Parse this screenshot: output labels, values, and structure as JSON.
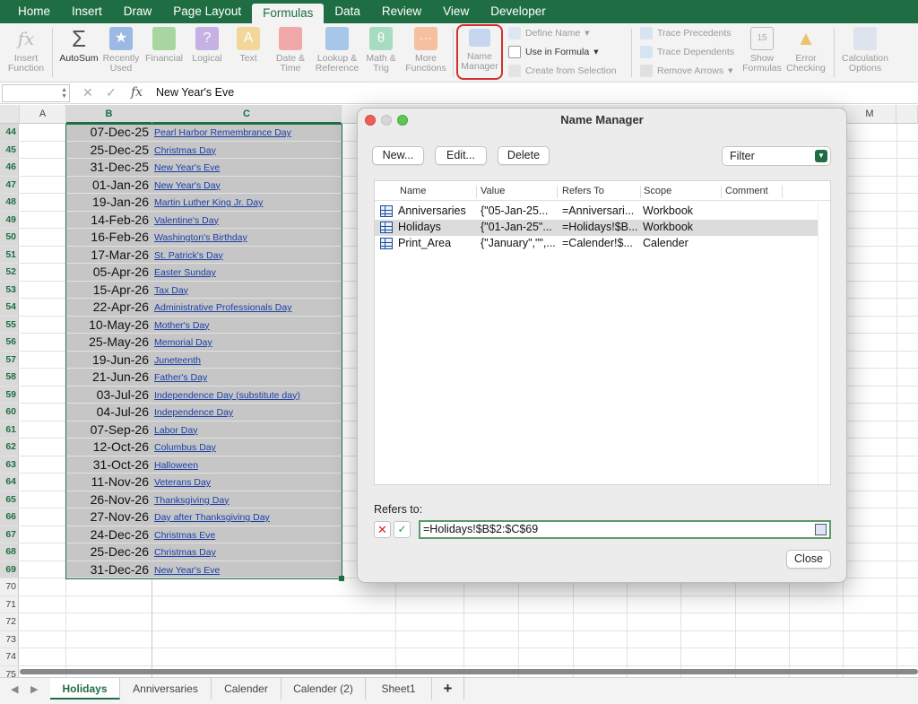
{
  "tabs": [
    "Home",
    "Insert",
    "Draw",
    "Page Layout",
    "Formulas",
    "Data",
    "Review",
    "View",
    "Developer"
  ],
  "active_tab": "Formulas",
  "ribbon": {
    "insert_function": "Insert Function",
    "autosum": "AutoSum",
    "recently_used": "Recently Used",
    "financial": "Financial",
    "logical": "Logical",
    "text": "Text",
    "date_time": "Date & Time",
    "lookup_reference": "Lookup & Reference",
    "math_trig": "Math & Trig",
    "more_functions": "More Functions",
    "name_manager": "Name Manager",
    "define_name": "Define Name",
    "use_in_formula": "Use in Formula",
    "create_from_selection": "Create from Selection",
    "trace_precedents": "Trace Precedents",
    "trace_dependents": "Trace Dependents",
    "remove_arrows": "Remove Arrows",
    "show_formulas": "Show Formulas",
    "error_checking": "Error Checking",
    "calculation_options": "Calculation Options"
  },
  "formula_bar": {
    "name_box": "",
    "fx": "fx",
    "content": "New Year's Eve"
  },
  "columns": [
    "A",
    "B",
    "C",
    "M"
  ],
  "rows": [
    {
      "n": "44",
      "date": "07-Dec-25",
      "holiday": "Pearl Harbor Remembrance Day"
    },
    {
      "n": "45",
      "date": "25-Dec-25",
      "holiday": "Christmas Day"
    },
    {
      "n": "46",
      "date": "31-Dec-25",
      "holiday": "New Year's Eve"
    },
    {
      "n": "47",
      "date": "01-Jan-26",
      "holiday": "New Year's Day"
    },
    {
      "n": "48",
      "date": "19-Jan-26",
      "holiday": "Martin Luther King Jr. Day"
    },
    {
      "n": "49",
      "date": "14-Feb-26",
      "holiday": "Valentine's Day"
    },
    {
      "n": "50",
      "date": "16-Feb-26",
      "holiday": "Washington's Birthday"
    },
    {
      "n": "51",
      "date": "17-Mar-26",
      "holiday": "St. Patrick's Day"
    },
    {
      "n": "52",
      "date": "05-Apr-26",
      "holiday": "Easter Sunday"
    },
    {
      "n": "53",
      "date": "15-Apr-26",
      "holiday": "Tax Day"
    },
    {
      "n": "54",
      "date": "22-Apr-26",
      "holiday": "Administrative Professionals Day"
    },
    {
      "n": "55",
      "date": "10-May-26",
      "holiday": "Mother's Day"
    },
    {
      "n": "56",
      "date": "25-May-26",
      "holiday": "Memorial Day"
    },
    {
      "n": "57",
      "date": "19-Jun-26",
      "holiday": "Juneteenth"
    },
    {
      "n": "58",
      "date": "21-Jun-26",
      "holiday": "Father's Day"
    },
    {
      "n": "59",
      "date": "03-Jul-26",
      "holiday": "Independence Day (substitute day)"
    },
    {
      "n": "60",
      "date": "04-Jul-26",
      "holiday": "Independence Day"
    },
    {
      "n": "61",
      "date": "07-Sep-26",
      "holiday": "Labor Day"
    },
    {
      "n": "62",
      "date": "12-Oct-26",
      "holiday": "Columbus Day"
    },
    {
      "n": "63",
      "date": "31-Oct-26",
      "holiday": "Halloween"
    },
    {
      "n": "64",
      "date": "11-Nov-26",
      "holiday": "Veterans Day"
    },
    {
      "n": "65",
      "date": "26-Nov-26",
      "holiday": "Thanksgiving Day"
    },
    {
      "n": "66",
      "date": "27-Nov-26",
      "holiday": "Day after Thanksgiving Day"
    },
    {
      "n": "67",
      "date": "24-Dec-26",
      "holiday": "Christmas Eve"
    },
    {
      "n": "68",
      "date": "25-Dec-26",
      "holiday": "Christmas Day"
    },
    {
      "n": "69",
      "date": "31-Dec-26",
      "holiday": "New Year's Eve"
    },
    {
      "n": "70",
      "date": "",
      "holiday": ""
    },
    {
      "n": "71",
      "date": "",
      "holiday": ""
    },
    {
      "n": "72",
      "date": "",
      "holiday": ""
    },
    {
      "n": "73",
      "date": "",
      "holiday": ""
    },
    {
      "n": "74",
      "date": "",
      "holiday": ""
    },
    {
      "n": "75",
      "date": "",
      "holiday": ""
    }
  ],
  "dialog": {
    "title": "Name Manager",
    "new_btn": "New...",
    "edit_btn": "Edit...",
    "delete_btn": "Delete",
    "filter": "Filter",
    "headers": {
      "name": "Name",
      "value": "Value",
      "refers_to": "Refers To",
      "scope": "Scope",
      "comment": "Comment"
    },
    "items": [
      {
        "name": "Anniversaries",
        "value": "{\"05-Jan-25...",
        "refers_to": "=Anniversari...",
        "scope": "Workbook"
      },
      {
        "name": "Holidays",
        "value": "{\"01-Jan-25\"...",
        "refers_to": "=Holidays!$B...",
        "scope": "Workbook"
      },
      {
        "name": "Print_Area",
        "value": "{\"January\",\"\",...",
        "refers_to": "=Calender!$...",
        "scope": "Calender"
      }
    ],
    "refers_to_label": "Refers to:",
    "refers_to_value": "=Holidays!$B$2:$C$69",
    "close_btn": "Close"
  },
  "sheets": [
    "Holidays",
    "Anniversaries",
    "Calender",
    "Calender (2)",
    "Sheet1"
  ],
  "active_sheet": "Holidays",
  "add_sheet": "+",
  "colors": {
    "excel_green": "#1f6e43",
    "highlight_red": "#d0312d",
    "link_blue": "#1a3fa8"
  }
}
